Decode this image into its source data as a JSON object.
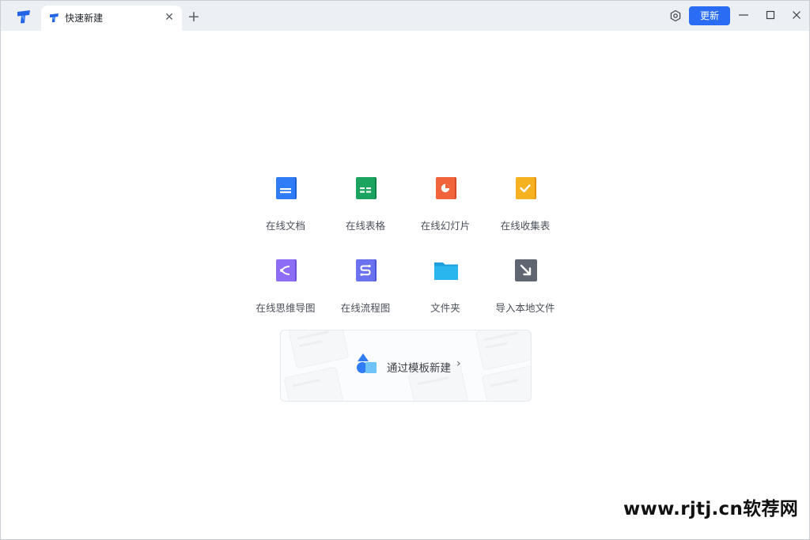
{
  "titlebar": {
    "app_logo_icon": "tencent-docs-logo-icon",
    "tab": {
      "title": "快速新建",
      "close_glyph": "✕",
      "icon": "tencent-docs-logo-icon"
    },
    "new_tab_glyph": "+",
    "settings_icon": "gear-icon",
    "update_label": "更新",
    "update_color": "#2a6df4",
    "window_controls": [
      "minimize-icon",
      "maximize-icon",
      "close-icon"
    ]
  },
  "tiles": [
    {
      "label": "在线文档",
      "icon": "document-icon",
      "color": "#2f7cf6"
    },
    {
      "label": "在线表格",
      "icon": "spreadsheet-icon",
      "color": "#1ba360"
    },
    {
      "label": "在线幻灯片",
      "icon": "slides-icon",
      "color": "#f0633b"
    },
    {
      "label": "在线收集表",
      "icon": "form-icon",
      "color": "#f5b120"
    },
    {
      "label": "在线思维导图",
      "icon": "mindmap-icon",
      "color": "#8d6cf6"
    },
    {
      "label": "在线流程图",
      "icon": "flowchart-icon",
      "color": "#6b72f0"
    },
    {
      "label": "文件夹",
      "icon": "folder-icon",
      "color": "#29b6ef"
    },
    {
      "label": "导入本地文件",
      "icon": "import-file-icon",
      "color": "#5f6672"
    }
  ],
  "template": {
    "label": "通过模板新建",
    "chevron": "›",
    "icon": "template-shapes-icon"
  },
  "watermark": "www.rjtj.cn软荐网"
}
